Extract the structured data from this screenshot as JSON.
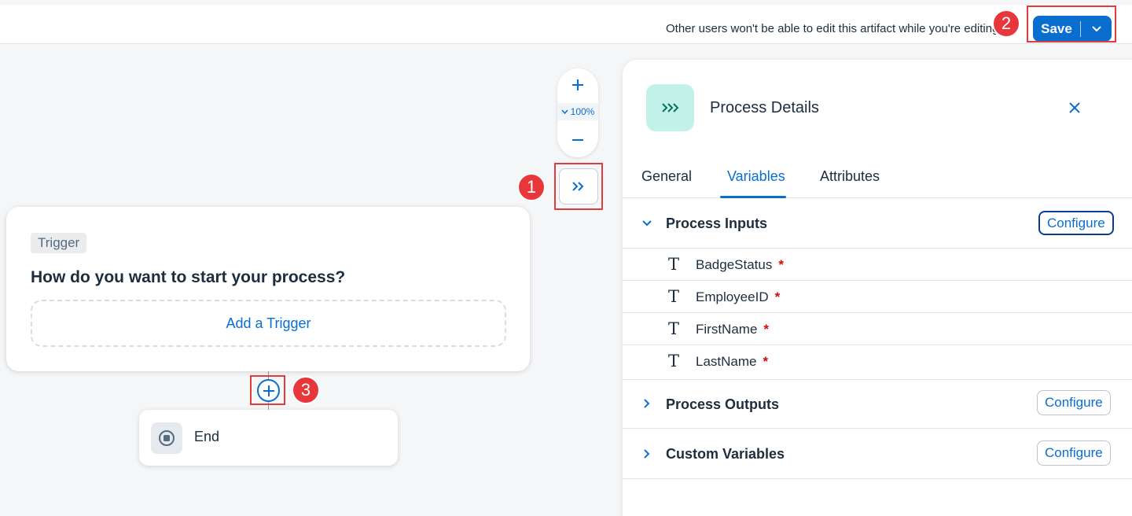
{
  "header": {
    "lock_message": "Other users won't be able to edit this artifact while you're editing",
    "save_label": "Save"
  },
  "annotations": {
    "step1": "1",
    "step2": "2",
    "step3": "3"
  },
  "zoom": {
    "level": "100%"
  },
  "canvas": {
    "trigger": {
      "tag": "Trigger",
      "question": "How do you want to start your process?",
      "add_label": "Add a Trigger"
    },
    "end": {
      "label": "End"
    }
  },
  "panel": {
    "title": "Process Details",
    "tabs": [
      {
        "label": "General"
      },
      {
        "label": "Variables"
      },
      {
        "label": "Attributes"
      }
    ],
    "sections": {
      "inputs": {
        "title": "Process Inputs",
        "configure_label": "Configure",
        "variables": [
          {
            "name": "BadgeStatus",
            "required": "*"
          },
          {
            "name": "EmployeeID",
            "required": "*"
          },
          {
            "name": "FirstName",
            "required": "*"
          },
          {
            "name": "LastName",
            "required": "*"
          }
        ]
      },
      "outputs": {
        "title": "Process Outputs",
        "configure_label": "Configure"
      },
      "custom": {
        "title": "Custom Variables",
        "configure_label": "Configure"
      }
    }
  },
  "colors": {
    "accent": "#0a6ed1",
    "annotation": "#e8373b",
    "panel_icon_bg": "#c2f1ea",
    "required": "#d20a0a"
  }
}
